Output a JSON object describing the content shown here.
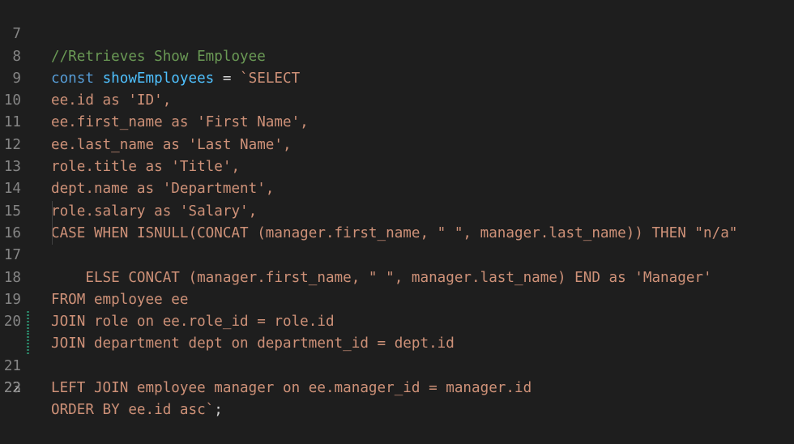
{
  "colors": {
    "background": "#1e1e1e",
    "line_number": "#858585",
    "line_number_active": "#c6c6c6",
    "comment": "#6a9955",
    "keyword": "#569cd6",
    "variable": "#4fc1ff",
    "operator": "#d4d4d4",
    "string": "#ce9178",
    "modified_gutter": "#2a7e63"
  },
  "editor": {
    "active_line": "22",
    "lines": [
      {
        "number": "7",
        "comment": "//Retrieves Show Employee"
      },
      {
        "number": "8",
        "keyword": "const",
        "variable": "showEmployees",
        "operator": "=",
        "string": "`SELECT"
      },
      {
        "number": "9",
        "text": "ee.id as 'ID',"
      },
      {
        "number": "10",
        "text": "ee.first_name as 'First Name',"
      },
      {
        "number": "11",
        "text": "ee.last_name as 'Last Name',"
      },
      {
        "number": "12",
        "text": "role.title as 'Title',"
      },
      {
        "number": "13",
        "text": "dept.name as 'Department',"
      },
      {
        "number": "14",
        "text": "role.salary as 'Salary',"
      },
      {
        "number": "15",
        "text": "CASE WHEN ISNULL(CONCAT (manager.first_name, \" \", manager.last_name)) THEN \"n/a\""
      },
      {
        "number": "16",
        "text": "    ELSE CONCAT (manager.first_name, \" \", manager.last_name) END as 'Manager'"
      },
      {
        "number": "17",
        "text": ""
      },
      {
        "number": "18",
        "text": "FROM employee ee"
      },
      {
        "number": "19",
        "text": "JOIN role on ee.role_id = role.id"
      },
      {
        "number": "20",
        "text": "JOIN department dept on department_id = dept.id"
      },
      {
        "number": "21",
        "text": "LEFT JOIN employee manager on ee.manager_id = manager.id"
      },
      {
        "number": "22",
        "text": "ORDER BY ee.id asc`",
        "punct": ";"
      },
      {
        "number": "23",
        "text": ""
      }
    ]
  }
}
